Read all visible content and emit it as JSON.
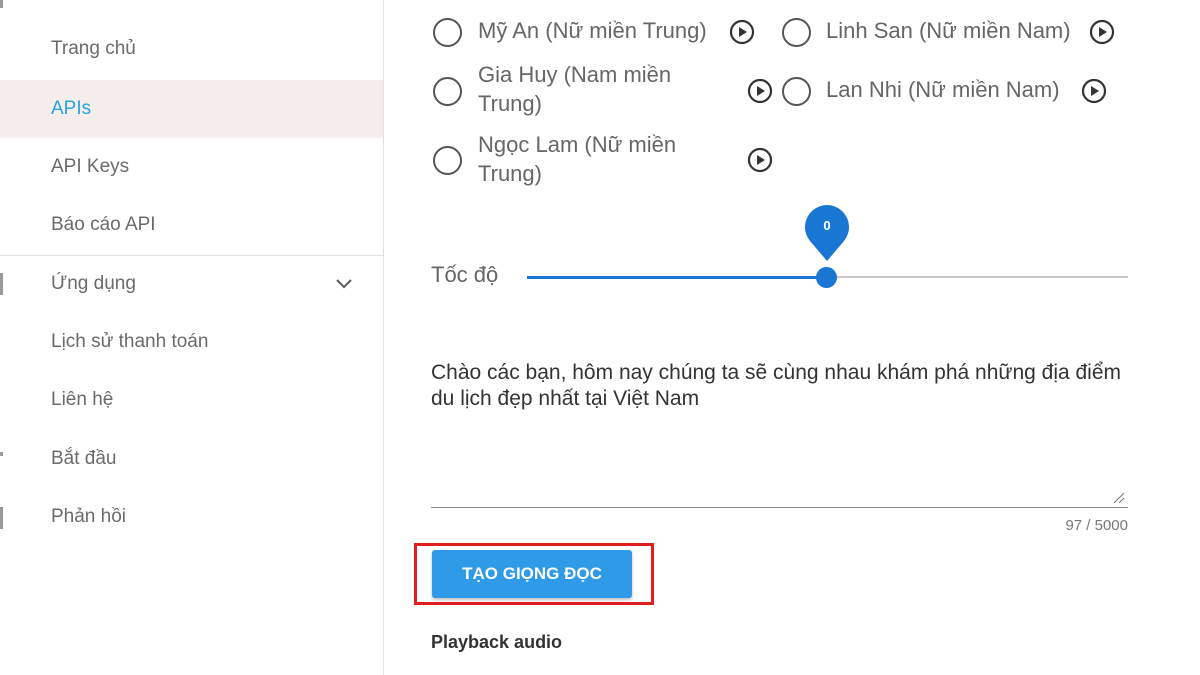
{
  "sidebar": {
    "items": [
      {
        "label": "Trang chủ"
      },
      {
        "label": "APIs"
      },
      {
        "label": "API Keys"
      },
      {
        "label": "Báo cáo API"
      },
      {
        "label": "Ứng dụng"
      },
      {
        "label": "Lịch sử thanh toán"
      },
      {
        "label": "Liên hệ"
      },
      {
        "label": "Bắt đầu"
      },
      {
        "label": "Phản hồi"
      }
    ],
    "active_item": "APIs",
    "expander_icon": "chevron-down-icon"
  },
  "voices": [
    {
      "line1": "Mỹ An (Nữ miền Trung)"
    },
    {
      "line1": "Linh San (Nữ miền Nam)"
    },
    {
      "line1": "Gia Huy (Nam miền",
      "line2": "Trung)"
    },
    {
      "line1": "Lan Nhi (Nữ miền Nam)"
    },
    {
      "line1": "Ngọc Lam (Nữ miền",
      "line2": "Trung)"
    }
  ],
  "speed": {
    "label": "Tốc độ",
    "value": "0",
    "value_fraction": 0.5
  },
  "text_input": {
    "value": "Chào các bạn, hôm nay chúng ta sẽ cùng nhau khám phá những địa điểm du lịch đẹp nhất tại Việt Nam",
    "counter": "97 / 5000"
  },
  "create_button": {
    "label": "TẠO GIỌNG ĐỌC"
  },
  "playback": {
    "title": "Playback audio"
  },
  "colors": {
    "accent_blue": "#1976d2",
    "button_blue": "#2e9ae8",
    "active_bg": "#f6eeec",
    "active_text": "#29a3e0",
    "highlight_red": "#e21d1d"
  }
}
